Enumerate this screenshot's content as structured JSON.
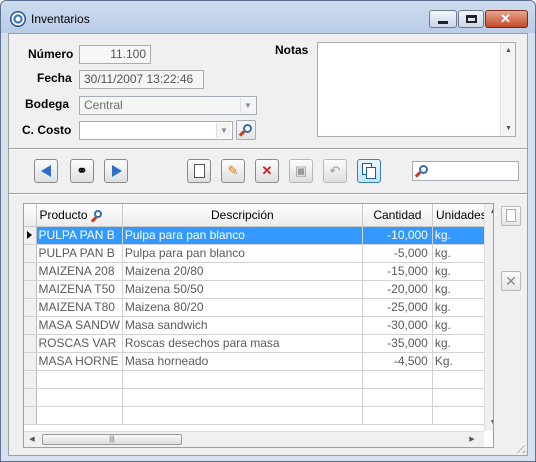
{
  "window": {
    "title": "Inventarios"
  },
  "form": {
    "numero_label": "Número",
    "numero_value": "11.100",
    "fecha_label": "Fecha",
    "fecha_value": "30/11/2007 13:22:46",
    "bodega_label": "Bodega",
    "bodega_value": "Central",
    "costo_label": "C. Costo",
    "costo_value": "",
    "notas_label": "Notas",
    "notas_value": ""
  },
  "toolbar": {
    "icons": [
      "prev-icon",
      "binoculars-icon",
      "next-icon",
      "new-doc-icon",
      "edit-pencil-icon",
      "delete-x-icon",
      "save-disk-icon",
      "undo-icon",
      "copy-icon",
      "search-icon"
    ]
  },
  "grid": {
    "columns": [
      "Producto",
      "Descripción",
      "Cantidad",
      "Unidades"
    ],
    "rows": [
      {
        "producto": "PULPA PAN B",
        "descripcion": "Pulpa para pan blanco",
        "cantidad": "-10,000",
        "unidades": "kg."
      },
      {
        "producto": "PULPA PAN B",
        "descripcion": "Pulpa para pan blanco",
        "cantidad": "-5,000",
        "unidades": "kg."
      },
      {
        "producto": "MAIZENA 208",
        "descripcion": "Maizena 20/80",
        "cantidad": "-15,000",
        "unidades": "kg."
      },
      {
        "producto": "MAIZENA T50",
        "descripcion": "Maizena 50/50",
        "cantidad": "-20,000",
        "unidades": "kg."
      },
      {
        "producto": "MAIZENA T80",
        "descripcion": "Maizena 80/20",
        "cantidad": "-25,000",
        "unidades": "kg."
      },
      {
        "producto": "MASA SANDW",
        "descripcion": "Masa sandwich",
        "cantidad": "-30,000",
        "unidades": "kg."
      },
      {
        "producto": "ROSCAS VAR",
        "descripcion": "Roscas desechos para masa",
        "cantidad": "-35,000",
        "unidades": "kg."
      },
      {
        "producto": "MASA HORNE",
        "descripcion": "Masa horneado",
        "cantidad": "-4,500",
        "unidades": "Kg."
      }
    ],
    "selected_index": 0
  },
  "colors": {
    "selection": "#3399ff",
    "nav_blue": "#2f6fc7",
    "delete_red": "#d21f1f"
  }
}
